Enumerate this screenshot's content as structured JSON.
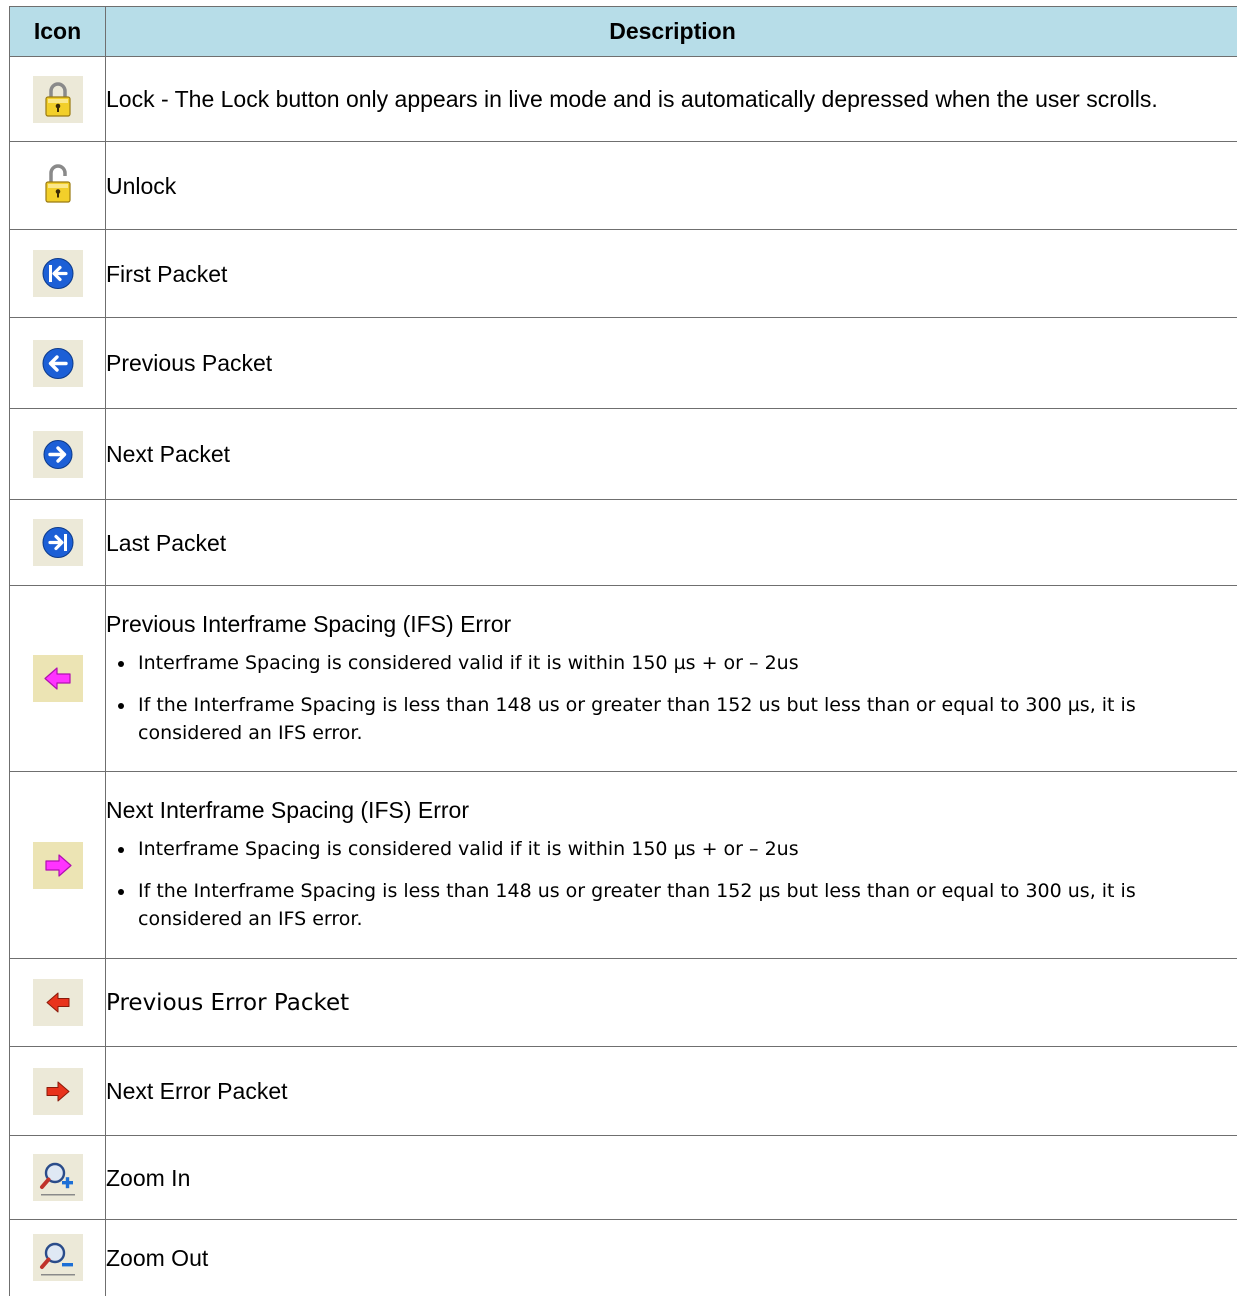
{
  "table": {
    "headers": {
      "icon": "Icon",
      "description": "Description"
    },
    "rows": [
      {
        "icon": "lock-icon",
        "description": "Lock - The Lock button only appears in live mode and is automatically depressed when the user scrolls."
      },
      {
        "icon": "unlock-icon",
        "description": "Unlock"
      },
      {
        "icon": "first-packet-icon",
        "description": "First Packet"
      },
      {
        "icon": "previous-packet-icon",
        "description": "Previous Packet"
      },
      {
        "icon": "next-packet-icon",
        "description": "Next Packet"
      },
      {
        "icon": "last-packet-icon",
        "description": "Last Packet"
      },
      {
        "icon": "previous-ifs-error-icon",
        "title": "Previous Interframe Spacing (IFS) Error",
        "bullets": [
          "Interframe Spacing is considered valid if it is within 150 µs + or – 2us",
          "If the Interframe Spacing is less than 148 us or greater than 152 us but less than or equal to 300 µs, it is considered an IFS error."
        ]
      },
      {
        "icon": "next-ifs-error-icon",
        "title": "Next Interframe Spacing (IFS) Error",
        "bullets": [
          "Interframe Spacing is considered valid if it is within 150 µs + or – 2us",
          "If the Interframe Spacing is less than 148 us or greater than 152 µs but less than or equal to 300 us, it is considered an IFS error."
        ]
      },
      {
        "icon": "previous-error-packet-icon",
        "description": "Previous Error Packet"
      },
      {
        "icon": "next-error-packet-icon",
        "description": "Next Error Packet"
      },
      {
        "icon": "zoom-in-icon",
        "description": "Zoom In"
      },
      {
        "icon": "zoom-out-icon",
        "description": "Zoom Out"
      }
    ]
  },
  "colors": {
    "header_background": "#b7dde8",
    "border": "#6f6f6f",
    "icon_background": "#ece9d8",
    "nav_blue": "#1c5fd6",
    "ifs_magenta": "#ff33ff",
    "error_red": "#e8331c",
    "lock_gold": "#e8c21a"
  }
}
